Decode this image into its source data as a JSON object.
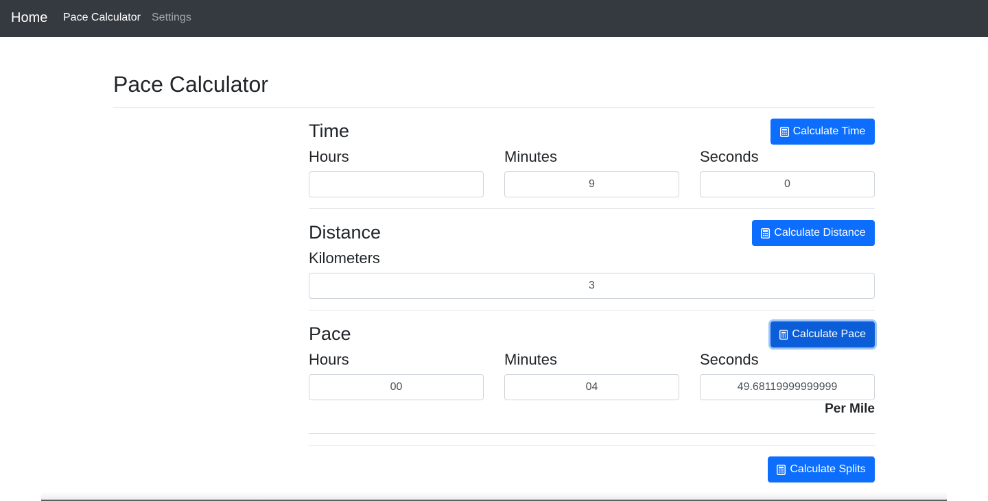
{
  "navbar": {
    "brand": "Home",
    "links": [
      {
        "label": "Pace Calculator",
        "active": true
      },
      {
        "label": "Settings",
        "active": false
      }
    ]
  },
  "page": {
    "title": "Pace Calculator"
  },
  "time": {
    "title": "Time",
    "button": "Calculate Time",
    "hours_label": "Hours",
    "minutes_label": "Minutes",
    "seconds_label": "Seconds",
    "hours": "",
    "minutes": "9",
    "seconds": "0"
  },
  "distance": {
    "title": "Distance",
    "button": "Calculate Distance",
    "unit_label": "Kilometers",
    "value": "3"
  },
  "pace": {
    "title": "Pace",
    "button": "Calculate Pace",
    "hours_label": "Hours",
    "minutes_label": "Minutes",
    "seconds_label": "Seconds",
    "hours": "00",
    "minutes": "04",
    "seconds": "49.68119999999999",
    "per_unit": "Per Mile"
  },
  "splits": {
    "button": "Calculate Splits"
  },
  "colors": {
    "navbar_bg": "#343a40",
    "primary": "#0d6efd",
    "divider": "#dee2e6",
    "input_border": "#ced4da"
  },
  "icons": {
    "calculator": "calculator-icon"
  }
}
